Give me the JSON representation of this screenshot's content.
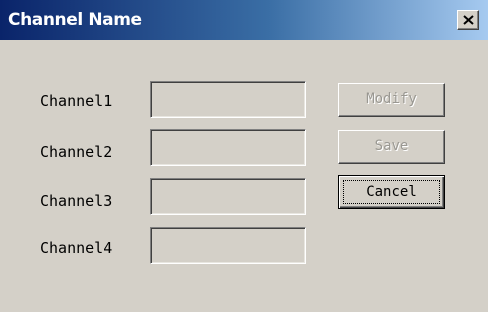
{
  "window": {
    "title": "Channel Name",
    "close_icon": "close-icon",
    "colors": {
      "title_start": "#0a246a",
      "title_end": "#a6caf0",
      "face": "#d4d0c8",
      "disabled_text": "#9a9892"
    }
  },
  "channels": [
    {
      "label": "Channel1",
      "value": ""
    },
    {
      "label": "Channel2",
      "value": ""
    },
    {
      "label": "Channel3",
      "value": ""
    },
    {
      "label": "Channel4",
      "value": ""
    }
  ],
  "buttons": {
    "modify": {
      "label": "Modify",
      "enabled": false
    },
    "save": {
      "label": "Save",
      "enabled": false
    },
    "cancel": {
      "label": "Cancel",
      "enabled": true,
      "default": true
    }
  }
}
